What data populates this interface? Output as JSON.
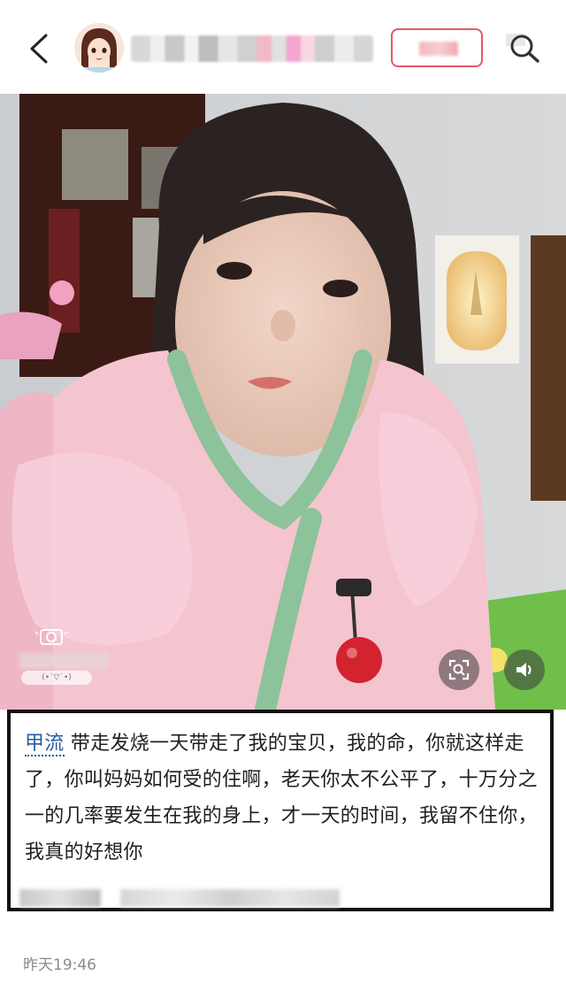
{
  "header": {
    "back_icon": "chevron-left-icon",
    "avatar_icon": "cartoon-girl-avatar",
    "follow_button_label": "",
    "search_icon": "search-icon"
  },
  "photo": {
    "camera_icon": "camera-icon",
    "watermark_text": "(•˙▽˙•)",
    "scan_icon": "scan-icon",
    "volume_icon": "volume-icon"
  },
  "post": {
    "topic": "甲流",
    "text": "带走发烧一天带走了我的宝贝，我的命，你就这样走了，你叫妈妈如何受的住啊，老天你太不公平了，十万分之一的几率要发生在我的身上，才一天的时间，我留不住你，我真的好想你",
    "timestamp": "昨天19:46"
  },
  "colors": {
    "topic_link": "#2a5d9a",
    "follow_border": "#e65a6a",
    "caption_border": "#111111"
  }
}
